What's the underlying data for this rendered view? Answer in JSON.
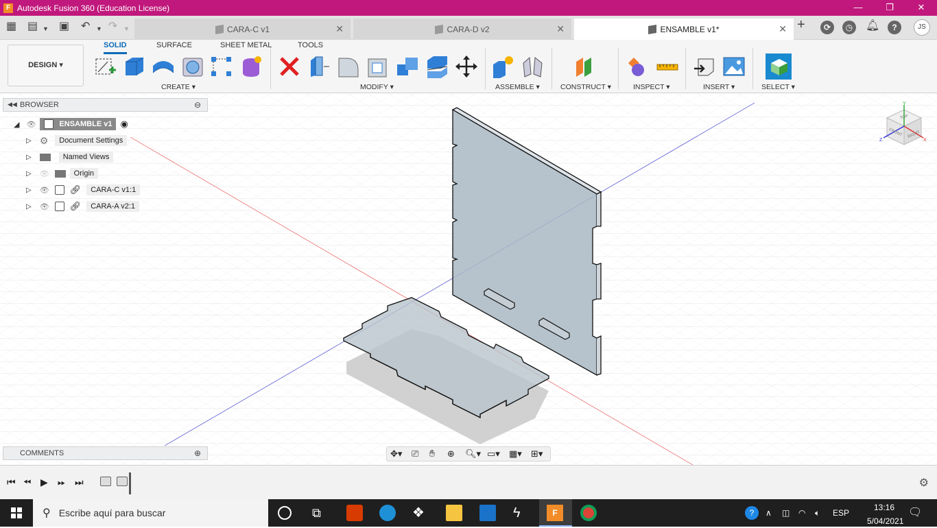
{
  "window": {
    "title": "Autodesk Fusion 360 (Education License)",
    "logo_letter": "F",
    "minimize": "—",
    "restore": "❐",
    "close": "✕"
  },
  "tabs": [
    {
      "label": "CARA-C v1",
      "active": false
    },
    {
      "label": "CARA-D v2",
      "active": false
    },
    {
      "label": "ENSAMBLE v1*",
      "active": true
    }
  ],
  "user": {
    "initials": "JS"
  },
  "toolbar": {
    "workspace": "DESIGN",
    "workspace_tabs": [
      "SOLID",
      "SURFACE",
      "SHEET METAL",
      "TOOLS"
    ],
    "groups": [
      "CREATE",
      "MODIFY",
      "ASSEMBLE",
      "CONSTRUCT",
      "INSPECT",
      "INSERT",
      "SELECT"
    ]
  },
  "browser": {
    "header": "BROWSER",
    "root": "ENSAMBLE v1",
    "items": [
      {
        "label": "Document Settings",
        "icon": "gear-icon"
      },
      {
        "label": "Named Views",
        "icon": "folder-icon"
      },
      {
        "label": "Origin",
        "icon": "folder-icon"
      },
      {
        "label": "CARA-C v1:1",
        "icon": "component-icon"
      },
      {
        "label": "CARA-A v2:1",
        "icon": "component-icon"
      }
    ]
  },
  "comments": {
    "header": "COMMENTS"
  },
  "viewcube": {
    "top": "TOP",
    "front": "FRONT",
    "right": "RIGHT",
    "x": "X",
    "y": "Y",
    "z": "Z"
  },
  "taskbar": {
    "search_placeholder": "Escribe aquí para buscar",
    "language": "ESP",
    "time": "13:16",
    "date": "5/04/2021"
  },
  "colors": {
    "titlebar": "#c0187c",
    "accent": "#0b6ab8",
    "part_fill": "#a9b8c3"
  }
}
